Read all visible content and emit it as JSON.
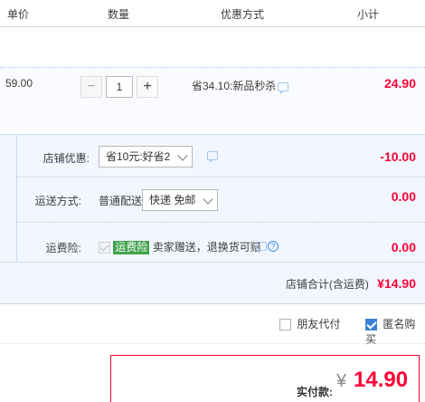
{
  "header": {
    "col_price": "单价",
    "col_qty": "数量",
    "col_promo": "优惠方式",
    "col_subtotal": "小计"
  },
  "item": {
    "price": "59.00",
    "quantity": "1",
    "promo": "省34.10:新品秒杀",
    "subtotal": "24.90"
  },
  "shop": {
    "discount_label": "店铺优惠:",
    "discount_option": "省10元:好省2",
    "discount_amount": "-10.00",
    "shipping_label": "运送方式:",
    "shipping_type": "普通配送",
    "shipping_option": "快递 免邮",
    "shipping_amount": "0.00",
    "insurance_label": "运费险:",
    "insurance_badge": "运费险",
    "insurance_desc": "卖家赠送，退换货可赔",
    "insurance_amount": "0.00",
    "total_label": "店铺合计(含运费)",
    "total_value": "¥14.90"
  },
  "options": {
    "friend_pay": "朋友代付",
    "anonymous": "匿名购买"
  },
  "payment": {
    "label": "实付款:",
    "currency": "¥",
    "value": "14.90"
  },
  "colors": {
    "accent_red": "#ff0036",
    "shop_bg": "#f2f7ff",
    "check_blue": "#3b82d8",
    "insurance_green": "#3fa34d"
  }
}
